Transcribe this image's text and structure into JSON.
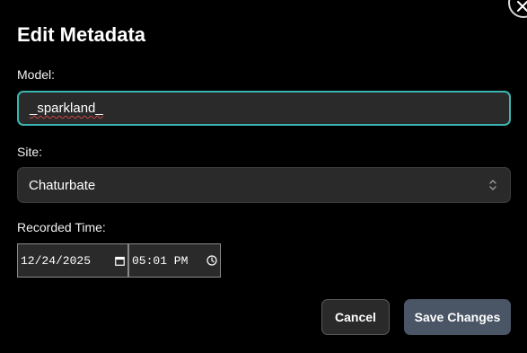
{
  "dialog": {
    "title": "Edit Metadata",
    "close_label": "Close"
  },
  "model": {
    "label": "Model:",
    "value": "_sparkland_"
  },
  "site": {
    "label": "Site:",
    "selected": "Chaturbate"
  },
  "recorded_time": {
    "label": "Recorded Time:",
    "date_value": "12/24/2025",
    "time_value": "05:01 PM"
  },
  "actions": {
    "cancel_label": "Cancel",
    "save_label": "Save Changes"
  },
  "icons": {
    "close": "close-icon",
    "select_chevron": "chevron-up-down-icon",
    "date_picker": "calendar-icon",
    "time_picker": "clock-icon"
  },
  "colors": {
    "background": "#000000",
    "field_bg": "#2a2a2a",
    "focus_border": "#3bb5b0",
    "save_button": "#4a5566"
  }
}
